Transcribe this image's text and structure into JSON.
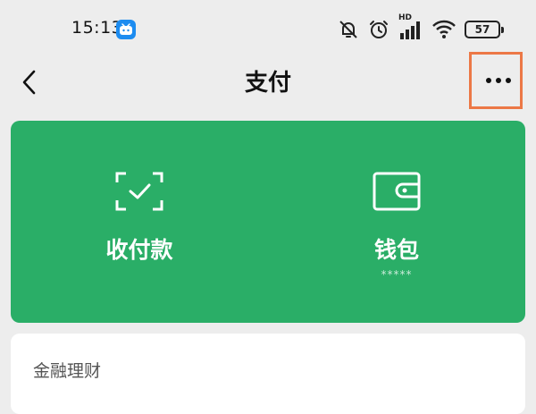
{
  "status_bar": {
    "time": "15:13",
    "app_icon": "bilibili-tv-icon",
    "icons": [
      "muted-bell-icon",
      "alarm-clock-icon",
      "hd-signal-icon",
      "wifi-icon"
    ],
    "hd_label": "HD",
    "battery_level": "57"
  },
  "nav": {
    "back_icon": "chevron-left-icon",
    "title": "支付",
    "more_icon": "more-dots-icon",
    "highlight_color": "#ec7846"
  },
  "pay_card": {
    "color": "#2aae67",
    "items": [
      {
        "label": "收付款",
        "icon": "scan-check-icon"
      },
      {
        "label": "钱包",
        "icon": "wallet-icon",
        "sub": "*****"
      }
    ]
  },
  "finance": {
    "title": "金融理财"
  }
}
